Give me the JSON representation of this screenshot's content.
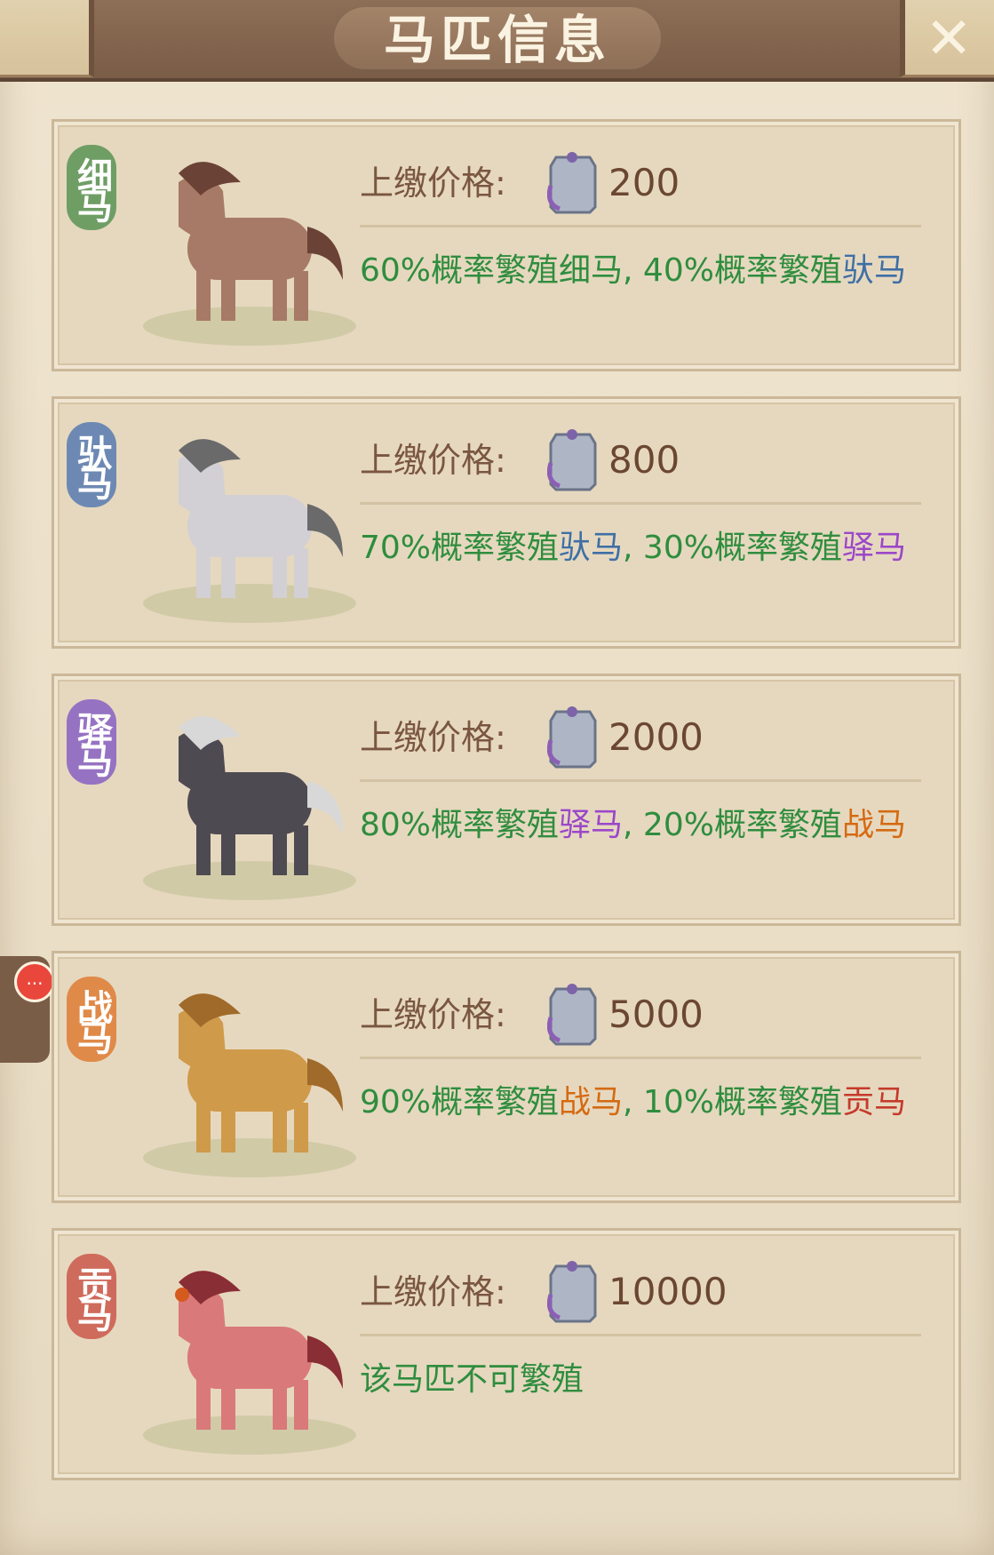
{
  "header": {
    "title": "马匹信息",
    "close_icon": "close-icon"
  },
  "notification": {
    "label": "..."
  },
  "price_label": "上缴价格:",
  "horses": [
    {
      "badge": "细马",
      "badge_color": "#6f9e65",
      "price": "200",
      "breed_parts": [
        "60%概率繁殖",
        "细马",
        ", 40%概率繁殖",
        "驮马"
      ]
    },
    {
      "badge": "驮马",
      "badge_color": "#6d89b3",
      "price": "800",
      "breed_parts": [
        "70%概率繁殖",
        "驮马",
        ", 30%概率繁殖",
        "驿马"
      ]
    },
    {
      "badge": "驿马",
      "badge_color": "#9672c2",
      "price": "2000",
      "breed_parts": [
        "80%概率繁殖",
        "驿马",
        ", 20%概率繁殖",
        "战马"
      ]
    },
    {
      "badge": "战马",
      "badge_color": "#e08a49",
      "price": "5000",
      "breed_parts": [
        "90%概率繁殖",
        "战马",
        ", 10%概率繁殖",
        "贡马"
      ]
    },
    {
      "badge": "贡马",
      "badge_color": "#cf6b5c",
      "price": "10000",
      "breed_text": "该马匹不可繁殖"
    }
  ]
}
